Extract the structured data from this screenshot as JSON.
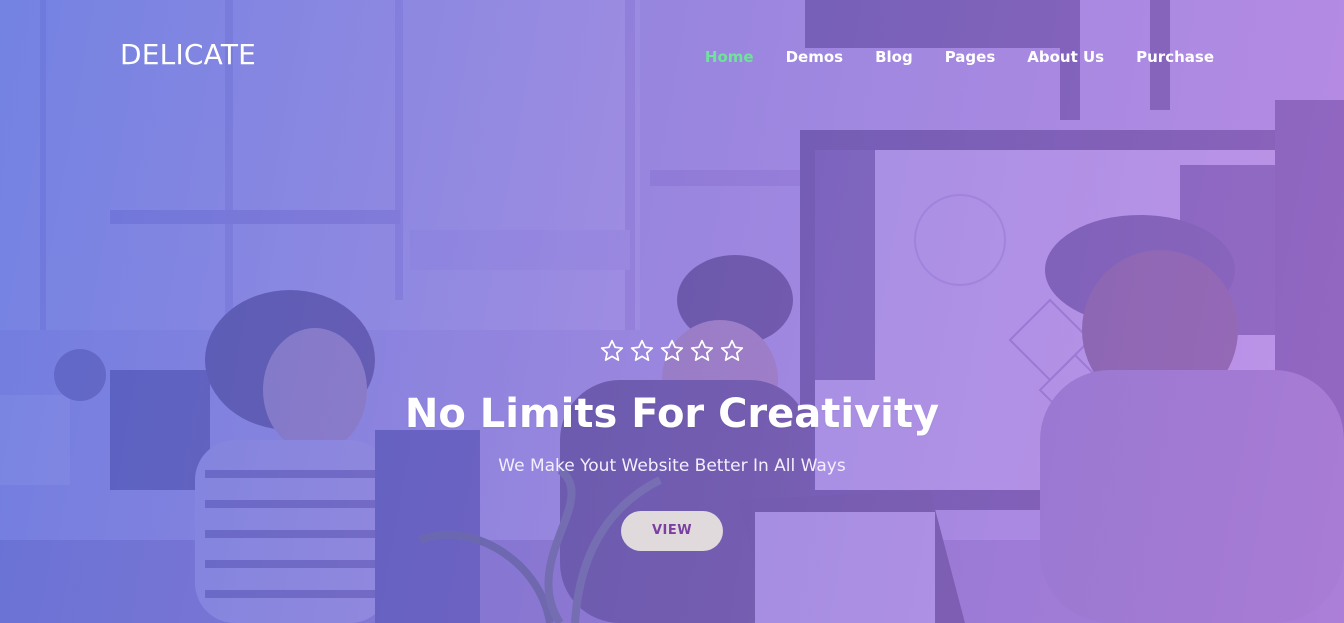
{
  "brand": {
    "logo_text": "DELICATE"
  },
  "nav": {
    "items": [
      {
        "label": "Home",
        "active": true
      },
      {
        "label": "Demos",
        "active": false
      },
      {
        "label": "Blog",
        "active": false
      },
      {
        "label": "Pages",
        "active": false
      },
      {
        "label": "About Us",
        "active": false
      },
      {
        "label": "Purchase",
        "active": false
      }
    ]
  },
  "hero": {
    "rating": {
      "filled": 0,
      "total": 5
    },
    "title": "No Limits For Creativity",
    "subtitle": "We Make Yout Website Better In All Ways",
    "button_label": "VIEW"
  },
  "colors": {
    "overlay_left": "#566ade",
    "overlay_right": "#b278e4",
    "active_nav": "#6fe39a",
    "button_bg": "#f0ece2",
    "button_text": "#7b3fa3",
    "text": "#ffffff"
  },
  "icons": {
    "rating_star": "star-outline-icon"
  }
}
